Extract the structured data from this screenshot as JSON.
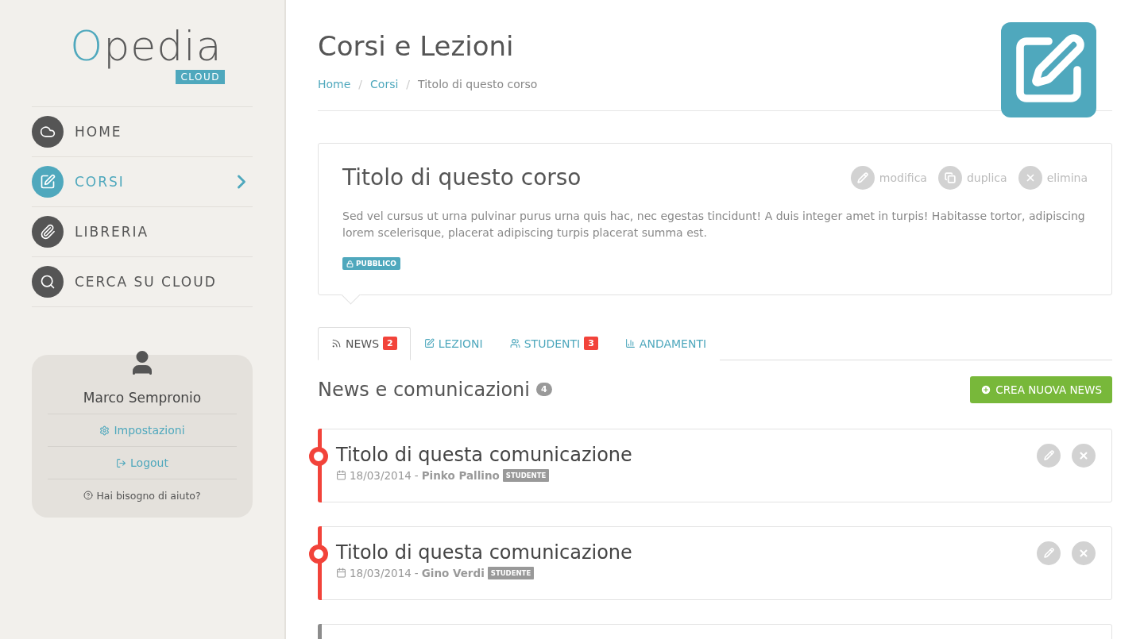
{
  "logo": {
    "wordmark": "Opedia",
    "badge": "CLOUD"
  },
  "sidebar": {
    "items": [
      {
        "label": "HOME",
        "selected": false
      },
      {
        "label": "CORSI",
        "selected": true
      },
      {
        "label": "LIBRERIA",
        "selected": false
      },
      {
        "label": "CERCA SU CLOUD",
        "selected": false
      }
    ]
  },
  "user": {
    "name": "Marco Sempronio",
    "links": [
      "Impostazioni",
      "Logout"
    ],
    "help": "Hai bisogno di aiuto?"
  },
  "page": {
    "title": "Corsi e Lezioni",
    "separator": "/",
    "breadcrumb": [
      {
        "label": "Home",
        "selected": false
      },
      {
        "label": "Corsi",
        "selected": false
      },
      {
        "label": "Titolo di questo corso",
        "selected": true
      }
    ]
  },
  "course": {
    "title": "Titolo di questo corso",
    "actions": [
      "modifica",
      "duplica",
      "elimina"
    ],
    "description": "Sed vel cursus ut urna pulvinar purus urna quis hac, nec egestas tincidunt! A duis integer amet in turpis! Habitasse tortor, adipiscing lorem scelerisque, placerat adipiscing turpis placerat summa est.",
    "visibility": "PUBBLICO"
  },
  "tabs": [
    {
      "label": "NEWS",
      "badge": "2",
      "selected": true
    },
    {
      "label": "LEZIONI",
      "selected": false
    },
    {
      "label": "STUDENTI",
      "badge": "3",
      "selected": false
    },
    {
      "label": "ANDAMENTI",
      "selected": false
    }
  ],
  "news": {
    "title": "News e comunicazioni",
    "count": "4",
    "create_button": "CREA NUOVA NEWS",
    "items": [
      {
        "title": "Titolo di questa comunicazione",
        "date": "18/03/2014",
        "dash": "-",
        "author": "Pinko Pallino",
        "role": "STUDENTE",
        "color": "#f2433a"
      },
      {
        "title": "Titolo di questa comunicazione",
        "date": "18/03/2014",
        "dash": "-",
        "author": "Gino Verdi",
        "role": "STUDENTE",
        "color": "#f2433a"
      },
      {
        "color": "#8c8c8c"
      }
    ]
  }
}
